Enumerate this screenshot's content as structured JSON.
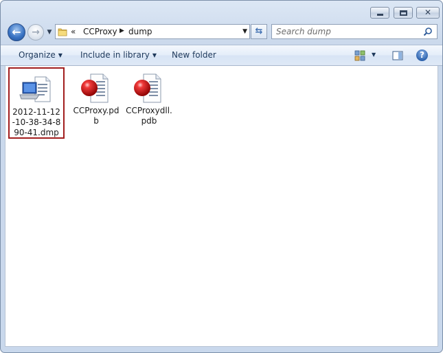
{
  "breadcrumb": {
    "overflow": "«",
    "items": [
      "CCProxy",
      "dump"
    ]
  },
  "search": {
    "placeholder": "Search dump"
  },
  "toolbar": {
    "organize": "Organize",
    "include_in_library": "Include in library",
    "new_folder": "New folder"
  },
  "files": [
    {
      "name": "2012-11-12-10-38-34-890-41.dmp",
      "display_lines": [
        "2012-11-12",
        "-10-38-34-8",
        "90-41.dmp"
      ],
      "icon": "dump-file-icon",
      "selected": true
    },
    {
      "name": "CCProxy.pdb",
      "display_lines": [
        "CCProxy.pd",
        "b"
      ],
      "icon": "pdb-file-icon",
      "selected": false
    },
    {
      "name": "CCProxydll.pdb",
      "display_lines": [
        "CCProxydll.",
        "pdb"
      ],
      "icon": "pdb-file-icon",
      "selected": false
    }
  ],
  "colors": {
    "selection_border": "#a11d1d",
    "toolbar_text": "#1e395b"
  }
}
